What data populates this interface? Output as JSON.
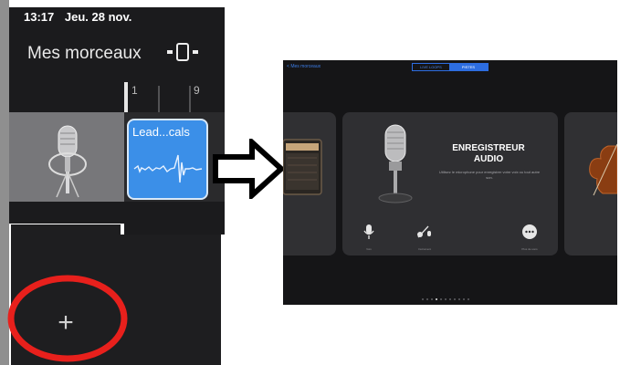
{
  "left_screen": {
    "status_time": "13:17",
    "status_date": "Jeu. 28 nov.",
    "title": "Mes morceaux",
    "ruler_marks": [
      "1",
      "9"
    ],
    "region_label": "Lead...cals",
    "add_track_label": "+"
  },
  "instrument_browser": {
    "back_label": "Mes morceaux",
    "segments": [
      "LIVE LOOPS",
      "PISTES"
    ],
    "selected_segment": "PISTES",
    "card_title_line1": "ENREGISTREUR",
    "card_title_line2": "AUDIO",
    "card_description": "Utilisez le microphone pour enregistrer votre voix ou tout autre son.",
    "options": [
      {
        "icon": "mic-icon",
        "label": "Voix"
      },
      {
        "icon": "guitar-mic-icon",
        "label": "Instrument"
      },
      {
        "icon": "more-icon",
        "label": "Plus de sons"
      }
    ],
    "page_dots": 11,
    "active_dot": 3
  },
  "colors": {
    "accent": "#2d6de0",
    "region": "#3b8fe8",
    "highlight_ring": "#e8201c"
  }
}
